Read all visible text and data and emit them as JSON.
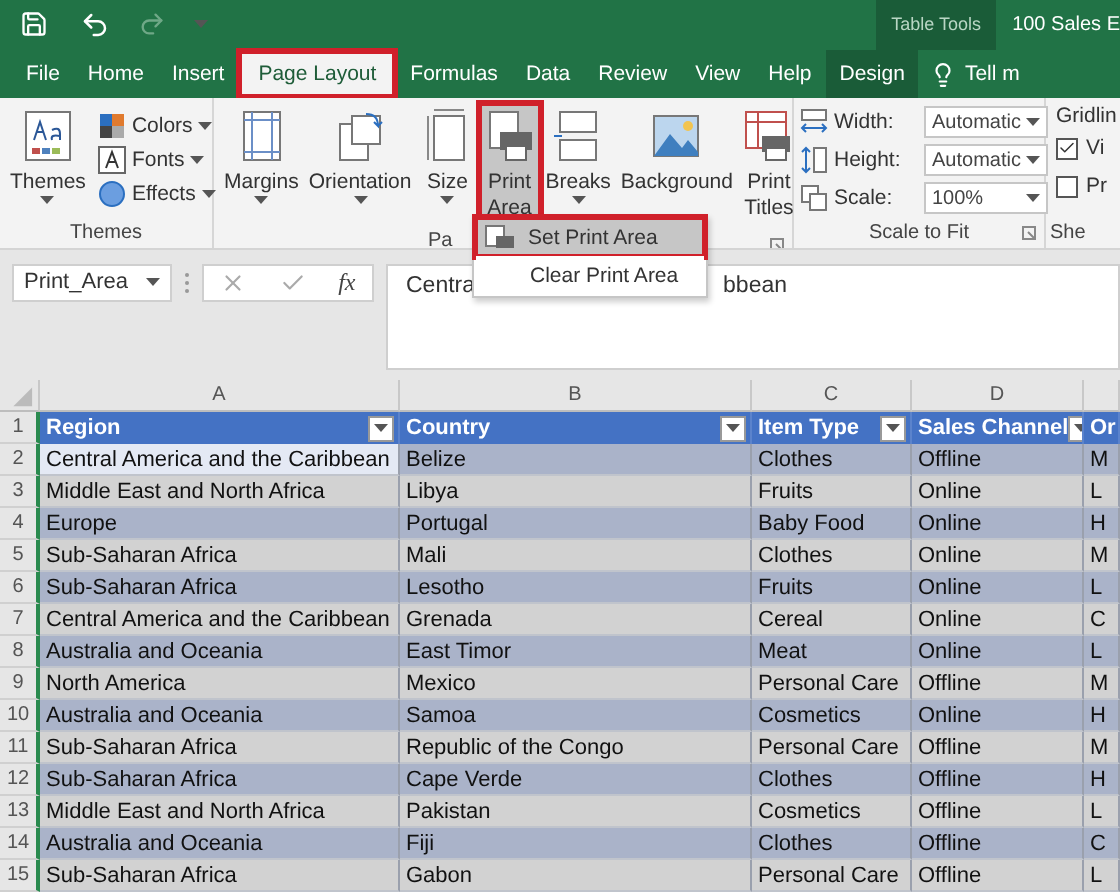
{
  "title_bar": {
    "context_label": "Table Tools",
    "document_title": "100 Sales E"
  },
  "tabs": [
    {
      "label": "File",
      "selected": false,
      "highlighted": false,
      "contextual": false
    },
    {
      "label": "Home",
      "selected": false,
      "highlighted": false,
      "contextual": false
    },
    {
      "label": "Insert",
      "selected": false,
      "highlighted": false,
      "contextual": false
    },
    {
      "label": "Page Layout",
      "selected": true,
      "highlighted": true,
      "contextual": false
    },
    {
      "label": "Formulas",
      "selected": false,
      "highlighted": false,
      "contextual": false
    },
    {
      "label": "Data",
      "selected": false,
      "highlighted": false,
      "contextual": false
    },
    {
      "label": "Review",
      "selected": false,
      "highlighted": false,
      "contextual": false
    },
    {
      "label": "View",
      "selected": false,
      "highlighted": false,
      "contextual": false
    },
    {
      "label": "Help",
      "selected": false,
      "highlighted": false,
      "contextual": false
    },
    {
      "label": "Design",
      "selected": false,
      "highlighted": false,
      "contextual": true
    }
  ],
  "tell_me": "Tell m",
  "ribbon": {
    "themes_group": {
      "label": "Themes",
      "big_button": "Themes",
      "small_buttons": [
        {
          "kind": "colors",
          "label": "Colors"
        },
        {
          "kind": "fonts",
          "label": "Fonts"
        },
        {
          "kind": "effects",
          "label": "Effects"
        }
      ]
    },
    "page_setup_group": {
      "label": "Pa",
      "buttons": [
        {
          "kind": "margins",
          "label": "Margins",
          "pressed": false,
          "highlighted": false
        },
        {
          "kind": "orientation",
          "label": "Orientation",
          "pressed": false,
          "highlighted": false
        },
        {
          "kind": "size",
          "label": "Size",
          "pressed": false,
          "highlighted": false
        },
        {
          "kind": "print_area",
          "label": "Print Area",
          "pressed": true,
          "highlighted": true
        },
        {
          "kind": "breaks",
          "label": "Breaks",
          "pressed": false,
          "highlighted": false
        },
        {
          "kind": "background",
          "label": "Background",
          "pressed": false,
          "highlighted": false
        },
        {
          "kind": "print_titles",
          "label": "Print Titles",
          "pressed": false,
          "highlighted": false
        }
      ]
    },
    "scale_group": {
      "label": "Scale to Fit",
      "rows": [
        {
          "kind": "width",
          "label": "Width:",
          "value": "Automatic"
        },
        {
          "kind": "height",
          "label": "Height:",
          "value": "Automatic"
        },
        {
          "kind": "scale",
          "label": "Scale:",
          "value": "100%"
        }
      ]
    },
    "sheet_group": {
      "heading": "Gridlin",
      "checkboxes": [
        {
          "label": "Vi",
          "checked": true
        },
        {
          "label": "Pr",
          "checked": false
        }
      ],
      "label": "She"
    }
  },
  "menu": {
    "items": [
      {
        "label": "Set Print Area",
        "hover": true,
        "highlighted": true
      },
      {
        "label": "Clear Print Area",
        "hover": false,
        "highlighted": false
      }
    ]
  },
  "formula_bar": {
    "name_box": "Print_Area",
    "function_label": "fx",
    "value_start": "Centra",
    "value_end": "bbean"
  },
  "grid": {
    "columns": [
      "A",
      "B",
      "C",
      "D"
    ],
    "header_row": {
      "number": "1",
      "cells": [
        "Region",
        "Country",
        "Item Type",
        "Sales Channel",
        "Or"
      ]
    },
    "rows": [
      {
        "number": "2",
        "active": true,
        "cells": [
          "Central America and the Caribbean",
          "Belize",
          "Clothes",
          "Offline",
          "M"
        ]
      },
      {
        "number": "3",
        "active": false,
        "cells": [
          "Middle East and North Africa",
          "Libya",
          "Fruits",
          "Online",
          "L"
        ]
      },
      {
        "number": "4",
        "active": false,
        "cells": [
          "Europe",
          "Portugal",
          "Baby Food",
          "Online",
          "H"
        ]
      },
      {
        "number": "5",
        "active": false,
        "cells": [
          "Sub-Saharan Africa",
          "Mali",
          "Clothes",
          "Online",
          "M"
        ]
      },
      {
        "number": "6",
        "active": false,
        "cells": [
          "Sub-Saharan Africa",
          "Lesotho",
          "Fruits",
          "Online",
          "L"
        ]
      },
      {
        "number": "7",
        "active": false,
        "cells": [
          "Central America and the Caribbean",
          "Grenada",
          "Cereal",
          "Online",
          "C"
        ]
      },
      {
        "number": "8",
        "active": false,
        "cells": [
          "Australia and Oceania",
          "East Timor",
          "Meat",
          "Online",
          "L"
        ]
      },
      {
        "number": "9",
        "active": false,
        "cells": [
          "North America",
          "Mexico",
          "Personal Care",
          "Offline",
          "M"
        ]
      },
      {
        "number": "10",
        "active": false,
        "cells": [
          "Australia and Oceania",
          "Samoa",
          "Cosmetics",
          "Online",
          "H"
        ]
      },
      {
        "number": "11",
        "active": false,
        "cells": [
          "Sub-Saharan Africa",
          "Republic of the Congo",
          "Personal Care",
          "Offline",
          "M"
        ]
      },
      {
        "number": "12",
        "active": false,
        "cells": [
          "Sub-Saharan Africa",
          "Cape Verde",
          "Clothes",
          "Offline",
          "H"
        ]
      },
      {
        "number": "13",
        "active": false,
        "cells": [
          "Middle East and North Africa",
          "Pakistan",
          "Cosmetics",
          "Offline",
          "L"
        ]
      },
      {
        "number": "14",
        "active": false,
        "cells": [
          "Australia and Oceania",
          "Fiji",
          "Clothes",
          "Offline",
          "C"
        ]
      },
      {
        "number": "15",
        "active": false,
        "cells": [
          "Sub-Saharan Africa",
          "Gabon",
          "Personal Care",
          "Offline",
          "L"
        ]
      }
    ]
  }
}
